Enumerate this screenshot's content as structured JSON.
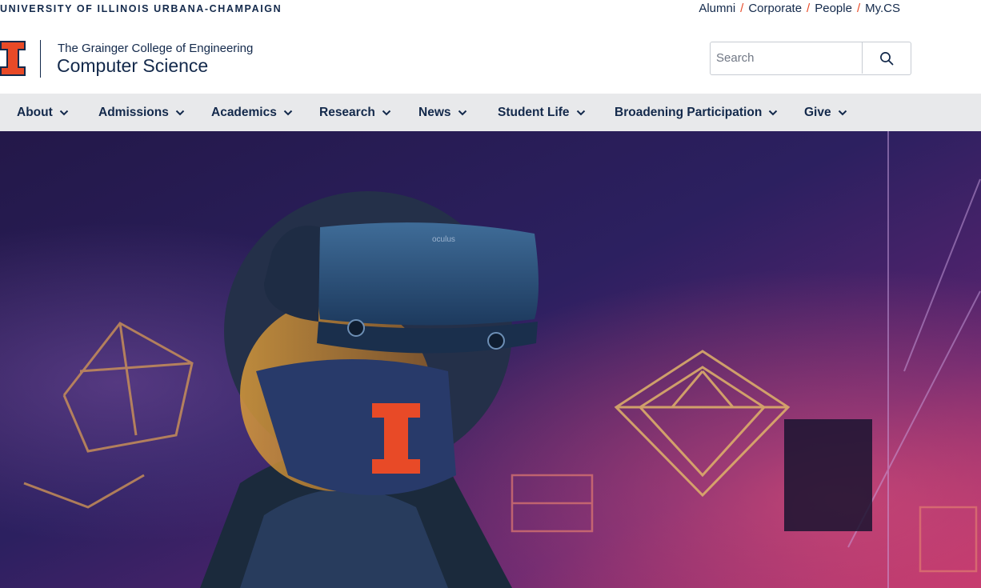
{
  "university": {
    "name": "UNIVERSITY OF ILLINOIS URBANA-CHAMPAIGN"
  },
  "utility_links": [
    {
      "label": "Alumni"
    },
    {
      "label": "Corporate"
    },
    {
      "label": "People"
    },
    {
      "label": "My.CS"
    }
  ],
  "utility_separator": "/",
  "brand": {
    "logo_icon": "block-i-icon",
    "college": "The Grainger College of Engineering",
    "department": "Computer Science"
  },
  "search": {
    "placeholder": "Search",
    "value": "",
    "button_icon": "search-icon"
  },
  "nav": {
    "items": [
      {
        "label": "About"
      },
      {
        "label": "Admissions"
      },
      {
        "label": "Academics"
      },
      {
        "label": "Research"
      },
      {
        "label": "News"
      },
      {
        "label": "Student Life"
      },
      {
        "label": "Broadening Participation"
      },
      {
        "label": "Give"
      }
    ],
    "chevron_icon": "chevron-down-icon"
  },
  "hero": {
    "description": "student-wearing-vr-headset-and-illinois-mask-photo",
    "headset_brand": "oculus"
  },
  "colors": {
    "navy": "#13294b",
    "orange": "#e84a27",
    "nav_bg": "#e8e9eb"
  }
}
